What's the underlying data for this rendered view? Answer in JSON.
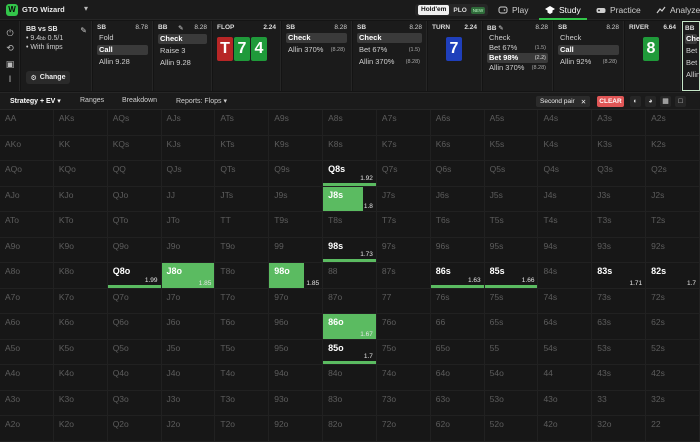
{
  "nav": {
    "logo": "W",
    "brand": "GTO Wizard",
    "game_types": {
      "holdem": "Hold'em",
      "plo": "PLO",
      "plo_badge": "NEW"
    },
    "tabs": [
      {
        "label": "Play",
        "icon": "controller-icon"
      },
      {
        "label": "Study",
        "icon": "graduation-cap-icon"
      },
      {
        "label": "Practice",
        "icon": "gamepad-icon"
      },
      {
        "label": "Analyze",
        "icon": "chart-icon"
      }
    ]
  },
  "spot": {
    "title": "BB vs SB",
    "stack": "• 9.4",
    "stack_unit": "bb",
    "blinds": " 0.5/1",
    "limps": "• With limps",
    "change": "Change"
  },
  "columns": [
    {
      "pos": "SB",
      "pot": "8.78",
      "actions": [
        {
          "label": "Fold"
        },
        {
          "label": "Call",
          "sel": true
        },
        {
          "label": "Allin 9.28"
        }
      ]
    },
    {
      "pos": "BB",
      "pot": "8.28",
      "actions": [
        {
          "label": "Check",
          "sel": true
        },
        {
          "label": "Raise 3"
        },
        {
          "label": "Allin 9.28"
        }
      ]
    },
    {
      "pos": "SB",
      "pot": "8.28",
      "actions": [
        {
          "label": "Check",
          "sel": true
        },
        {
          "label": "Allin 370%",
          "sub": "(8.28)"
        }
      ]
    },
    {
      "pos": "SB",
      "pot": "8.28",
      "actions": [
        {
          "label": "Check",
          "sel": true
        },
        {
          "label": "Bet 67%",
          "sub": "(1.5)"
        },
        {
          "label": "Allin 370%",
          "sub": "(8.28)"
        }
      ]
    },
    {
      "pos": "BB",
      "pot": "8.28",
      "actions": [
        {
          "label": "Check"
        },
        {
          "label": "Bet 67%",
          "sub": "(1.5)"
        },
        {
          "label": "Bet 98%",
          "sub": "(2.2)",
          "sel": true
        },
        {
          "label": "Allin 370%",
          "sub": "(8.28)"
        }
      ]
    },
    {
      "pos": "SB",
      "pot": "8.28",
      "actions": [
        {
          "label": "Check"
        },
        {
          "label": "Call",
          "sel": true
        },
        {
          "label": "Allin 92%",
          "sub": "(8.28)"
        }
      ]
    },
    {
      "pos": "BB",
      "pot": "",
      "actions": [
        {
          "label": "Check",
          "sel": true
        },
        {
          "label": "Bet"
        },
        {
          "label": "Bet"
        },
        {
          "label": "Allin"
        }
      ]
    }
  ],
  "streets": {
    "flop": {
      "label": "FLOP",
      "pot": "2.24",
      "cards": [
        "T",
        "7",
        "4"
      ]
    },
    "turn": {
      "label": "TURN",
      "pot": "2.24",
      "cards": [
        "7"
      ]
    },
    "river": {
      "label": "RIVER",
      "pot": "6.64",
      "cards": [
        "8"
      ]
    }
  },
  "toolbar": {
    "strategy": "Strategy + EV",
    "ranges": "Ranges",
    "breakdown": "Breakdown",
    "reports": "Reports: Flops",
    "filter": "Second pair",
    "clear": "CLEAR"
  },
  "grid": [
    [
      "AA",
      "AKs",
      "AQs",
      "AJs",
      "ATs",
      "A9s",
      "A8s",
      "A7s",
      "A6s",
      "A5s",
      "A4s",
      "A3s",
      "A2s"
    ],
    [
      "AKo",
      "KK",
      "KQs",
      "KJs",
      "KTs",
      "K9s",
      "K8s",
      "K7s",
      "K6s",
      "K5s",
      "K4s",
      "K3s",
      "K2s"
    ],
    [
      "AQo",
      "KQo",
      "QQ",
      "QJs",
      "QTs",
      "Q9s",
      "Q8s",
      "Q7s",
      "Q6s",
      "Q5s",
      "Q4s",
      "Q3s",
      "Q2s"
    ],
    [
      "AJo",
      "KJo",
      "QJo",
      "JJ",
      "JTs",
      "J9s",
      "J8s",
      "J7s",
      "J6s",
      "J5s",
      "J4s",
      "J3s",
      "J2s"
    ],
    [
      "ATo",
      "KTo",
      "QTo",
      "JTo",
      "TT",
      "T9s",
      "T8s",
      "T7s",
      "T6s",
      "T5s",
      "T4s",
      "T3s",
      "T2s"
    ],
    [
      "A9o",
      "K9o",
      "Q9o",
      "J9o",
      "T9o",
      "99",
      "98s",
      "97s",
      "96s",
      "95s",
      "94s",
      "93s",
      "92s"
    ],
    [
      "A8o",
      "K8o",
      "Q8o",
      "J8o",
      "T8o",
      "98o",
      "88",
      "87s",
      "86s",
      "85s",
      "84s",
      "83s",
      "82s"
    ],
    [
      "A7o",
      "K7o",
      "Q7o",
      "J7o",
      "T7o",
      "97o",
      "87o",
      "77",
      "76s",
      "75s",
      "74s",
      "73s",
      "72s"
    ],
    [
      "A6o",
      "K6o",
      "Q6o",
      "J6o",
      "T6o",
      "96o",
      "86o",
      "76o",
      "66",
      "65s",
      "64s",
      "63s",
      "62s"
    ],
    [
      "A5o",
      "K5o",
      "Q5o",
      "J5o",
      "T5o",
      "95o",
      "85o",
      "75o",
      "65o",
      "55",
      "54s",
      "53s",
      "52s"
    ],
    [
      "A4o",
      "K4o",
      "Q4o",
      "J4o",
      "T4o",
      "94o",
      "84o",
      "74o",
      "64o",
      "54o",
      "44",
      "43s",
      "42s"
    ],
    [
      "A3o",
      "K3o",
      "Q3o",
      "J3o",
      "T3o",
      "93o",
      "83o",
      "73o",
      "63o",
      "53o",
      "43o",
      "33",
      "32s"
    ],
    [
      "A2o",
      "K2o",
      "Q2o",
      "J2o",
      "T2o",
      "92o",
      "82o",
      "72o",
      "62o",
      "52o",
      "42o",
      "32o",
      "22"
    ]
  ],
  "highlights": {
    "Q8s": {
      "ev": "1.92",
      "fill": 0.15
    },
    "J8s": {
      "ev": "1.8",
      "fill": 0.75
    },
    "98s": {
      "ev": "1.73",
      "fill": 0.15
    },
    "Q8o": {
      "ev": "1.99",
      "fill": 0.15
    },
    "J8o": {
      "ev": "1.85",
      "fill": 1.0
    },
    "98o": {
      "ev": "1.85",
      "fill": 0.65
    },
    "86s": {
      "ev": "1.63",
      "fill": 0.15
    },
    "85s": {
      "ev": "1.66",
      "fill": 0.15
    },
    "83s": {
      "ev": "1.71",
      "fill": 0
    },
    "82s": {
      "ev": "1.7",
      "fill": 0
    },
    "86o": {
      "ev": "1.67",
      "fill": 1.0
    },
    "85o": {
      "ev": "1.7",
      "fill": 0.15
    }
  },
  "colors": {
    "action_green": "#5bbb61",
    "accent": "#33c64a",
    "clear_red": "#e05656"
  }
}
